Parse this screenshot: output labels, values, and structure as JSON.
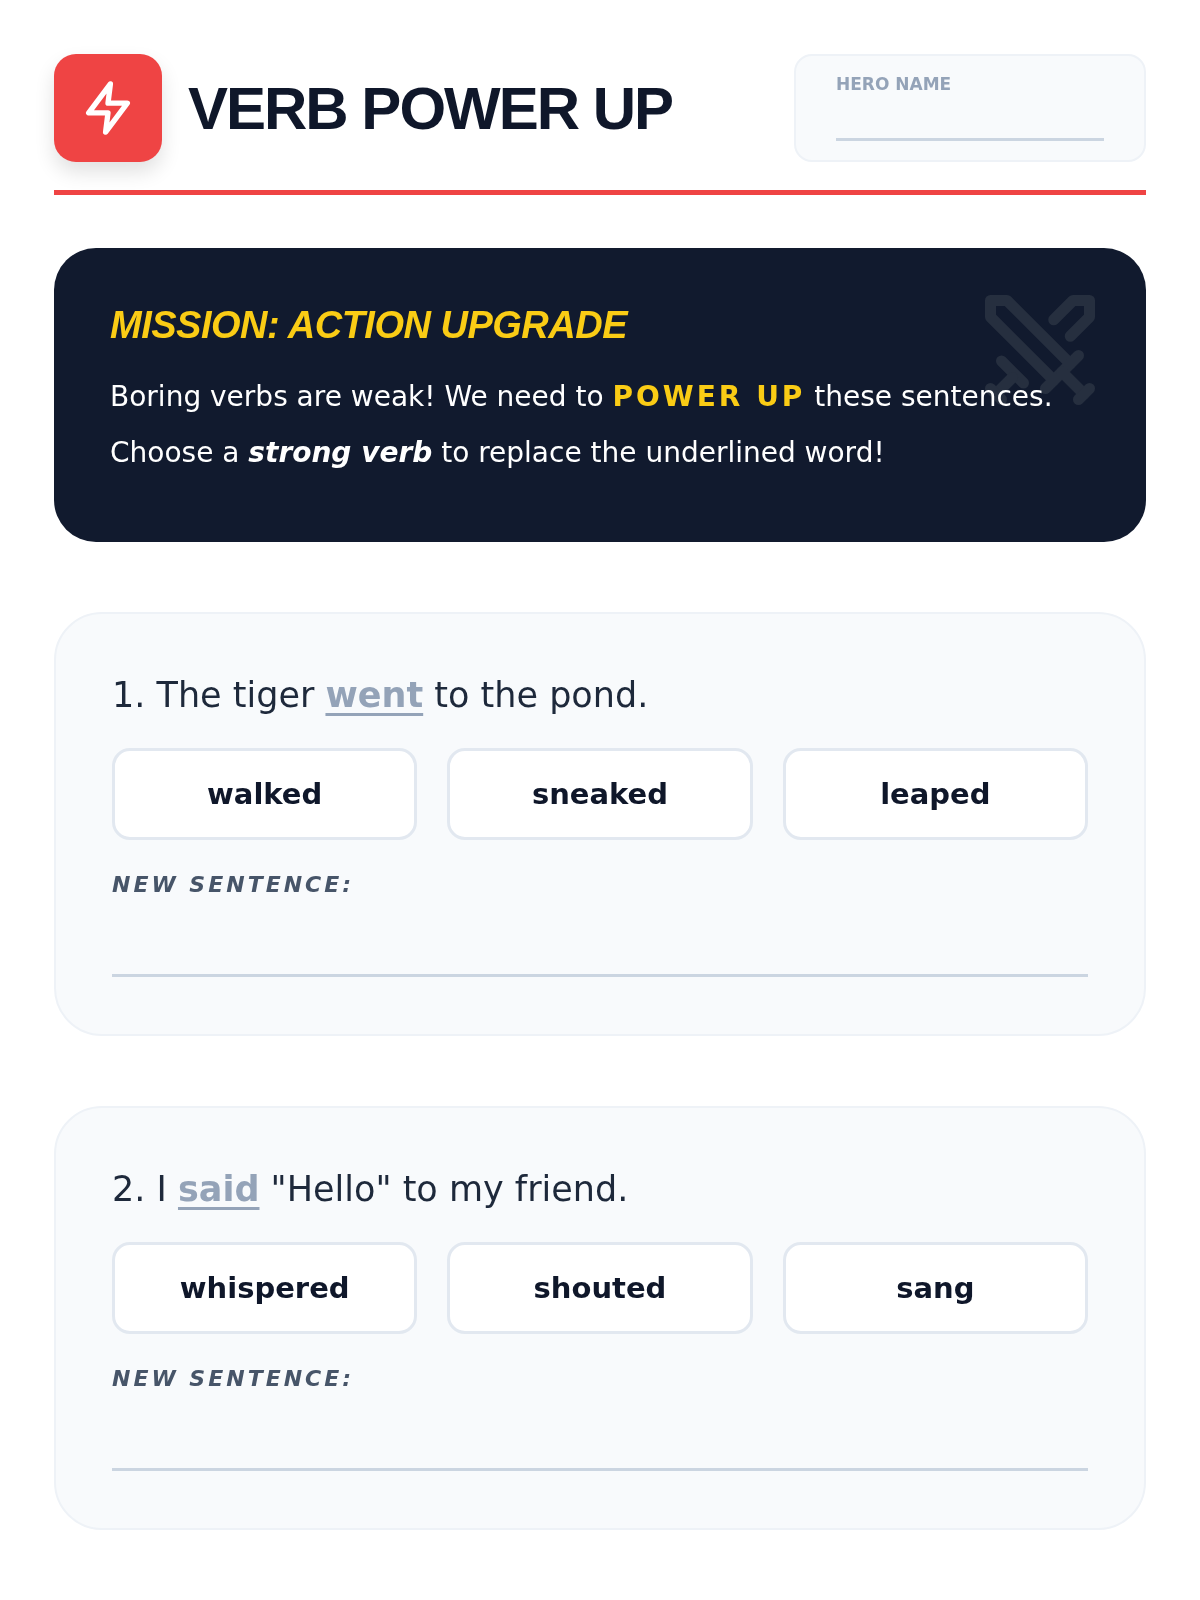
{
  "header": {
    "title": "VERB POWER UP",
    "hero_field": {
      "label": "HERO NAME"
    }
  },
  "mission": {
    "title": "MISSION: ACTION UPGRADE",
    "text": [
      {
        "kind": "plain",
        "text": "Boring verbs are weak! We need to "
      },
      {
        "kind": "highlight",
        "text": "POWER UP"
      },
      {
        "kind": "plain",
        "text": " these sentences. Choose a "
      },
      {
        "kind": "emphasis",
        "text": "strong verb"
      },
      {
        "kind": "plain",
        "text": " to replace the underlined word!"
      }
    ]
  },
  "questions": [
    {
      "number": "1.",
      "before": "The tiger",
      "verb": "went",
      "after": "to the pond.",
      "choices": [
        {
          "label": "walked",
          "selected": false
        },
        {
          "label": "sneaked",
          "selected": false
        },
        {
          "label": "leaped",
          "selected": false
        }
      ],
      "answer_label": "NEW SENTENCE:"
    },
    {
      "number": "2.",
      "before": "I",
      "verb": "said",
      "after": "\"Hello\" to my friend.",
      "choices": [
        {
          "label": "whispered",
          "selected": false
        },
        {
          "label": "shouted",
          "selected": false
        },
        {
          "label": "sang",
          "selected": false
        }
      ],
      "answer_label": "NEW SENTENCE:"
    }
  ]
}
